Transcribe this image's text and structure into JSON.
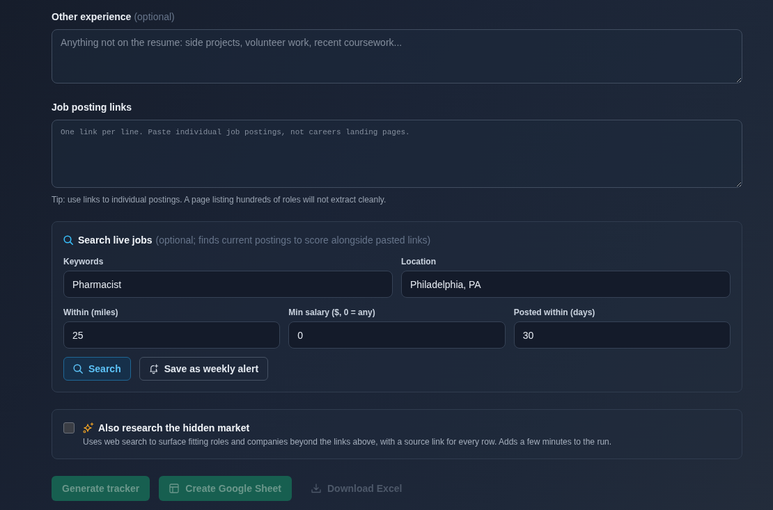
{
  "other_experience": {
    "label": "Other experience",
    "hint": "(optional)",
    "placeholder": "Anything not on the resume: side projects, volunteer work, recent coursework..."
  },
  "job_links": {
    "label": "Job posting links",
    "placeholder": "One link per line. Paste individual job postings, not careers landing pages.",
    "tip": "Tip: use links to individual postings. A page listing hundreds of roles will not extract cleanly."
  },
  "live_search": {
    "title": "Search live jobs",
    "note": "(optional; finds current postings to score alongside pasted links)",
    "field_rows": [
      {
        "fields": [
          {
            "label": "Keywords",
            "value": "Pharmacist"
          },
          {
            "label": "Location",
            "value": "Philadelphia, PA"
          }
        ]
      },
      {
        "fields": [
          {
            "label": "Within (miles)",
            "value": "25"
          },
          {
            "label": "Min salary ($, 0 = any)",
            "value": "0"
          },
          {
            "label": "Posted within (days)",
            "value": "30"
          }
        ]
      }
    ],
    "buttons": [
      {
        "kind": "search",
        "label": "Search"
      },
      {
        "kind": "alert",
        "label": "Save as weekly alert"
      }
    ]
  },
  "hidden_market": {
    "checked": false,
    "title": "Also research the hidden market",
    "description": "Uses web search to surface fitting roles and companies beyond the links above, with a source link for every row. Adds a few minutes to the run."
  },
  "actions": [
    {
      "kind": "generate",
      "label": "Generate tracker",
      "disabled": true
    },
    {
      "kind": "sheet",
      "label": "Create Google Sheet",
      "disabled": true
    },
    {
      "kind": "download",
      "label": "Download Excel",
      "disabled": true
    }
  ]
}
